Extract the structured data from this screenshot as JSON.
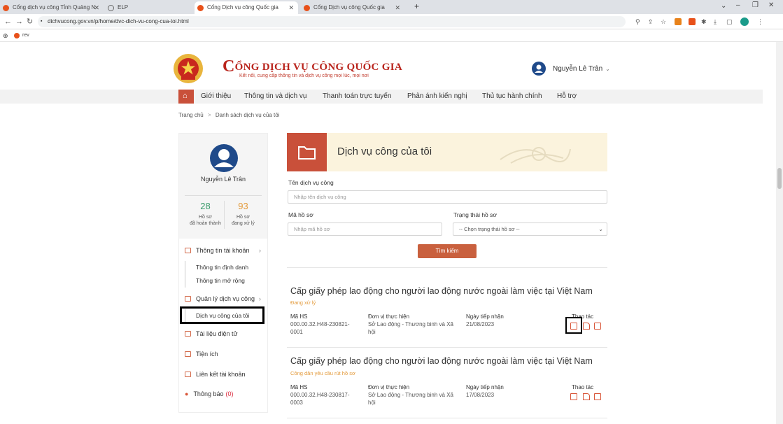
{
  "browser": {
    "tabs": [
      {
        "label": "Cổng dịch vụ công Tỉnh Quảng N"
      },
      {
        "label": "ELP"
      },
      {
        "label": "Cổng Dịch vụ công Quốc gia"
      },
      {
        "label": "Cổng Dịch vụ công Quốc gia"
      }
    ],
    "url": "dichvucong.gov.vn/p/home/dvc-dich-vu-cong-cua-toi.html",
    "bookmark": "rev"
  },
  "header": {
    "title_initial": "C",
    "title_rest": "ỔNG DỊCH VỤ CÔNG QUỐC GIA",
    "tagline": "Kết nối, cung cấp thông tin và dịch vụ công mọi lúc, mọi nơi",
    "user_name": "Nguyễn Lê Trân"
  },
  "menu": [
    "Giới thiệu",
    "Thông tin và dịch vụ",
    "Thanh toán trực tuyến",
    "Phản ánh kiến nghị",
    "Thủ tục hành chính",
    "Hỗ trợ"
  ],
  "breadcrumb": {
    "home": "Trang chủ",
    "sep": ">",
    "current": "Danh sách dịch vụ của tôi"
  },
  "sidebar": {
    "name": "Nguyễn Lê Trân",
    "stats": [
      {
        "value": "28",
        "label1": "Hồ sơ",
        "label2": "đã hoàn thành",
        "color": "#3a9b6b"
      },
      {
        "value": "93",
        "label1": "Hồ sơ",
        "label2": "đang xử lý",
        "color": "#e39a3b"
      }
    ],
    "account": "Thông tin tài khoản",
    "account_sub": [
      "Thông tin định danh",
      "Thông tin mở rộng"
    ],
    "manage": "Quản lý dịch vụ công",
    "my_services": "Dịch vụ công của tôi",
    "documents": "Tài liệu điện tử",
    "utilities": "Tiện ích",
    "linked": "Liên kết tài khoản",
    "notify": "Thông báo",
    "notify_count": "(0)"
  },
  "main": {
    "banner_title": "Dịch vụ công của tôi",
    "service_label": "Tên dịch vụ công",
    "service_placeholder": "Nhập tên dịch vụ công",
    "code_label": "Mã hồ sơ",
    "code_placeholder": "Nhập mã hồ sơ",
    "status_label": "Trạng thái hồ sơ",
    "status_value": "-- Chọn trạng thái hồ sơ --",
    "search_label": "Tìm kiếm",
    "col_code": "Mã HS",
    "col_unit": "Đơn vị thực hiện",
    "col_date": "Ngày tiếp nhận",
    "col_action": "Thao tác",
    "records": [
      {
        "title": "Cấp giấy phép lao động cho người lao động nước ngoài làm việc tại Việt Nam",
        "status": "Đang xử lý",
        "code1": "000.00.32.H48-230821-",
        "code2": "0001",
        "unit1": "Sở Lao động - Thương binh và Xã",
        "unit2": "hội",
        "date": "21/08/2023"
      },
      {
        "title": "Cấp giấy phép lao động cho người lao động nước ngoài làm việc tại Việt Nam",
        "status": "Công dân yêu cầu rút hồ sơ",
        "code1": "000.00.32.H48-230817-",
        "code2": "0003",
        "unit1": "Sở Lao động - Thương binh và Xã",
        "unit2": "hội",
        "date": "17/08/2023"
      }
    ]
  }
}
